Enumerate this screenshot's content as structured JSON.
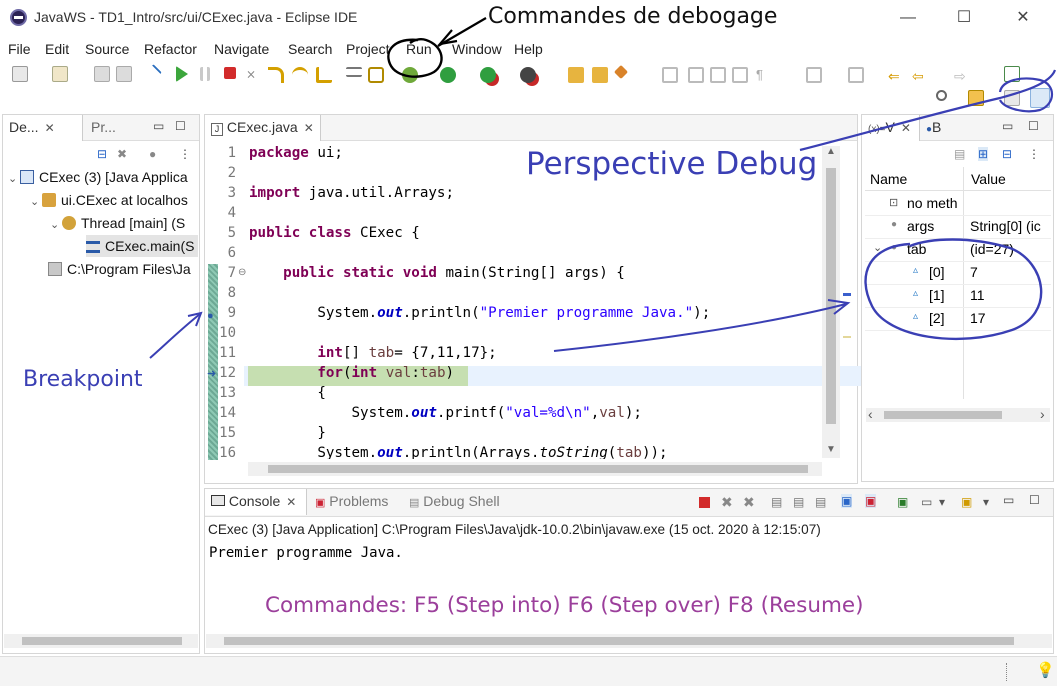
{
  "window": {
    "title": "JavaWS - TD1_Intro/src/ui/CExec.java - Eclipse IDE",
    "minimize": "—",
    "maximize": "☐",
    "close": "✕"
  },
  "menu": [
    "File",
    "Edit",
    "Source",
    "Refactor",
    "Navigate",
    "Search",
    "Project",
    "Run",
    "Window",
    "Help"
  ],
  "left_panel": {
    "tabs": [
      "De...",
      "Pr..."
    ],
    "tree": [
      "CExec (3) [Java Applica",
      "ui.CExec at localhos",
      "Thread [main] (S",
      "CExec.main(S",
      "C:\\Program Files\\Ja"
    ]
  },
  "editor": {
    "tab": "CExec.java",
    "line_numbers": [
      "1",
      "2",
      "3",
      "4",
      "5",
      "6",
      "7",
      "8",
      "9",
      "10",
      "11",
      "12",
      "13",
      "14",
      "15",
      "16"
    ]
  },
  "variables": {
    "tabs": [
      "V",
      "B"
    ],
    "col_name": "Name",
    "col_value": "Value",
    "rows": [
      {
        "name": "no meth",
        "value": ""
      },
      {
        "name": "args",
        "value": "String[0]  (ic"
      },
      {
        "name": "tab",
        "value": "(id=27)"
      },
      {
        "name": "[0]",
        "value": "7"
      },
      {
        "name": "[1]",
        "value": "11"
      },
      {
        "name": "[2]",
        "value": "17"
      }
    ]
  },
  "console": {
    "tabs": [
      "Console",
      "Problems",
      "Debug Shell"
    ],
    "header": "CExec (3) [Java Application] C:\\Program Files\\Java\\jdk-10.0.2\\bin\\javaw.exe  (15 oct. 2020 à 12:15:07)",
    "output": "Premier programme Java."
  },
  "annotations": {
    "top": "Commandes de debogage",
    "perspective": "Perspective Debug",
    "breakpoint": "Breakpoint",
    "commands": "Commandes: F5 (Step into) F6 (Step over) F8 (Resume)"
  },
  "colors": {
    "annotation_blue": "#3a3fb4",
    "annotation_purple": "#9b3f9b",
    "keyword": "#7f0055",
    "string": "#2a00ff"
  }
}
